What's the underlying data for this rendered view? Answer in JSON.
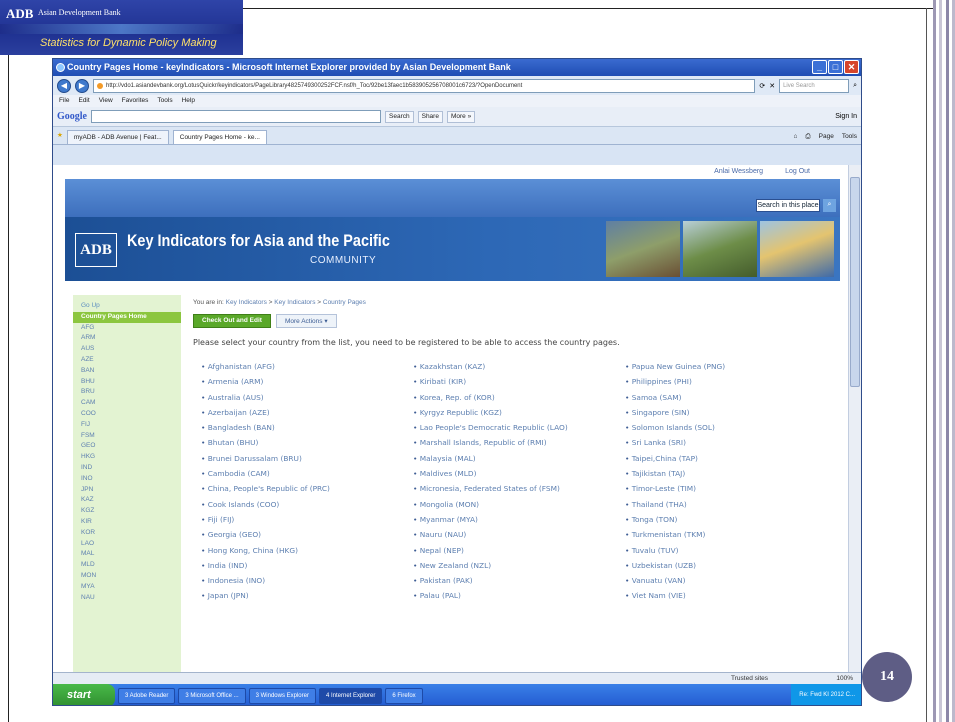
{
  "banner": {
    "logo": "ADB",
    "org_name": "Asian Development Bank",
    "tagline": "Statistics for Dynamic Policy Making"
  },
  "browser": {
    "title": "Country Pages Home - keyIndicators - Microsoft Internet Explorer provided by Asian Development Bank",
    "address": "http://vdo1.asiandevbank.org/LotusQuickr/keyindicators/PageLibrary4825749300252FCF.nsf/h_Toc/92be13faec1b583905256708001c6723/?OpenDocument",
    "live_search_placeholder": "Live Search",
    "menu": [
      "File",
      "Edit",
      "View",
      "Favorites",
      "Tools",
      "Help"
    ],
    "google_label": "Google",
    "google_buttons": [
      "Search",
      "Share",
      "More »"
    ],
    "sign_in": "Sign In",
    "tabs": [
      "myADB - ADB Avenue | Feat...",
      "Country Pages Home - ke..."
    ],
    "tab_tools": [
      "Page",
      "Tools"
    ]
  },
  "page": {
    "user_links": [
      "Anlai Wessberg",
      "Log Out"
    ],
    "search_label": "Search in this place",
    "header_logo": "ADB",
    "header_title": "Key Indicators for Asia and the Pacific",
    "header_subtitle": "COMMUNITY",
    "nav": {
      "go_up": "Go Up",
      "current": "Country Pages Home",
      "items": [
        "AFG",
        "ARM",
        "AUS",
        "AZE",
        "BAN",
        "BHU",
        "BRU",
        "CAM",
        "COO",
        "FIJ",
        "FSM",
        "GEO",
        "HKG",
        "IND",
        "INO",
        "JPN",
        "KAZ",
        "KGZ",
        "KIR",
        "KOR",
        "LAO",
        "MAL",
        "MLD",
        "MON",
        "MYA",
        "NAU"
      ]
    },
    "breadcrumb_prefix": "You are in:",
    "breadcrumb": [
      "Key Indicators",
      "Key Indicators",
      "Country Pages"
    ],
    "buttons": {
      "check_out": "Check Out and Edit",
      "more_actions": "More Actions ▾"
    },
    "instructions": "Please select your country from the list, you need to be registered to be able to access the country pages.",
    "columns": [
      [
        "Afghanistan (AFG)",
        "Armenia (ARM)",
        "Australia (AUS)",
        "Azerbaijan (AZE)",
        "Bangladesh (BAN)",
        "Bhutan (BHU)",
        "Brunei Darussalam (BRU)",
        "Cambodia (CAM)",
        "China, People's Republic of (PRC)",
        "Cook Islands (COO)",
        "Fiji (FIJ)",
        "Georgia (GEO)",
        "Hong Kong, China (HKG)",
        "India (IND)",
        "Indonesia (INO)",
        "Japan (JPN)"
      ],
      [
        "Kazakhstan (KAZ)",
        "Kiribati (KIR)",
        "Korea, Rep. of (KOR)",
        "Kyrgyz Republic (KGZ)",
        "Lao People's Democratic Republic (LAO)",
        "Marshall Islands, Republic of (RMI)",
        "Malaysia (MAL)",
        "Maldives (MLD)",
        "Micronesia, Federated States of (FSM)",
        "Mongolia (MON)",
        "Myanmar (MYA)",
        "Nauru (NAU)",
        "Nepal (NEP)",
        "New Zealand (NZL)",
        "Pakistan (PAK)",
        "Palau (PAL)"
      ],
      [
        "Papua New Guinea (PNG)",
        "Philippines (PHI)",
        "Samoa (SAM)",
        "Singapore (SIN)",
        "Solomon Islands (SOL)",
        "Sri Lanka (SRI)",
        "Taipei,China (TAP)",
        "Tajikistan (TAJ)",
        "Timor-Leste (TIM)",
        "Thailand (THA)",
        "Tonga (TON)",
        "Turkmenistan (TKM)",
        "Tuvalu (TUV)",
        "Uzbekistan (UZB)",
        "Vanuatu (VAN)",
        "Viet Nam (VIE)"
      ]
    ]
  },
  "status": {
    "trusted": "Trusted sites",
    "zoom": "100%"
  },
  "taskbar": {
    "start": "start",
    "tasks": [
      "3 Adobe Reader",
      "3 Microsoft Office ...",
      "3 Windows Explorer",
      "4 Internet Explorer",
      "6 Firefox"
    ],
    "tray": "Re: Fwd KI 2012 C..."
  },
  "slide_number": "14",
  "colors": {
    "accent_green": "#8cc63f",
    "adb_blue": "#2d68b6",
    "link_blue": "#5d7fb0",
    "page_badge": "#5e5d85"
  }
}
